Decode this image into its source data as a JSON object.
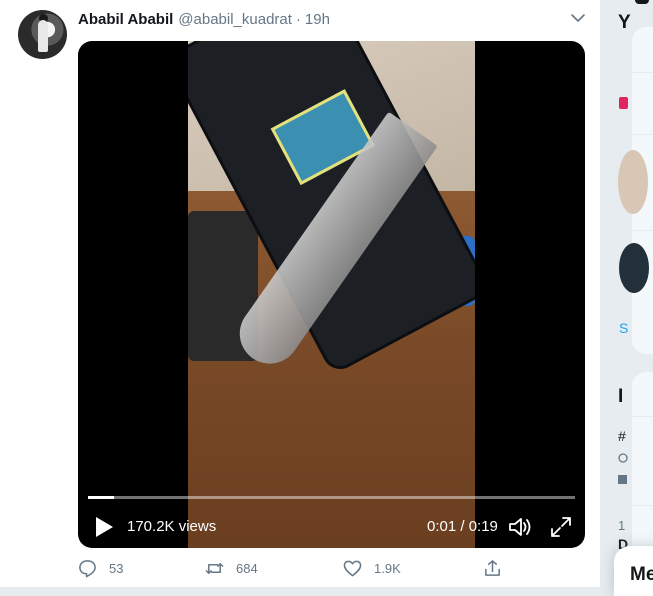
{
  "tweet": {
    "display_name": "Ababil Ababil",
    "handle": "@ababil_kuadrat",
    "separator": "·",
    "time": "19h"
  },
  "video": {
    "views": "170.2K views",
    "timecode": "0:01 / 0:19",
    "progress": 0.053
  },
  "actions": {
    "reply_count": "53",
    "retweet_count": "684",
    "like_count": "1.9K"
  },
  "sidebar": {
    "card1_letter": "Y",
    "card1_link": "S",
    "card2_letter": "I",
    "card2_hashtag": "#",
    "card2_count": "1",
    "card2_bold": "D"
  },
  "messages": {
    "label": "Me"
  },
  "colors": {
    "accent": "#1da1f2",
    "like": "#e0245e",
    "muted": "#657786"
  }
}
